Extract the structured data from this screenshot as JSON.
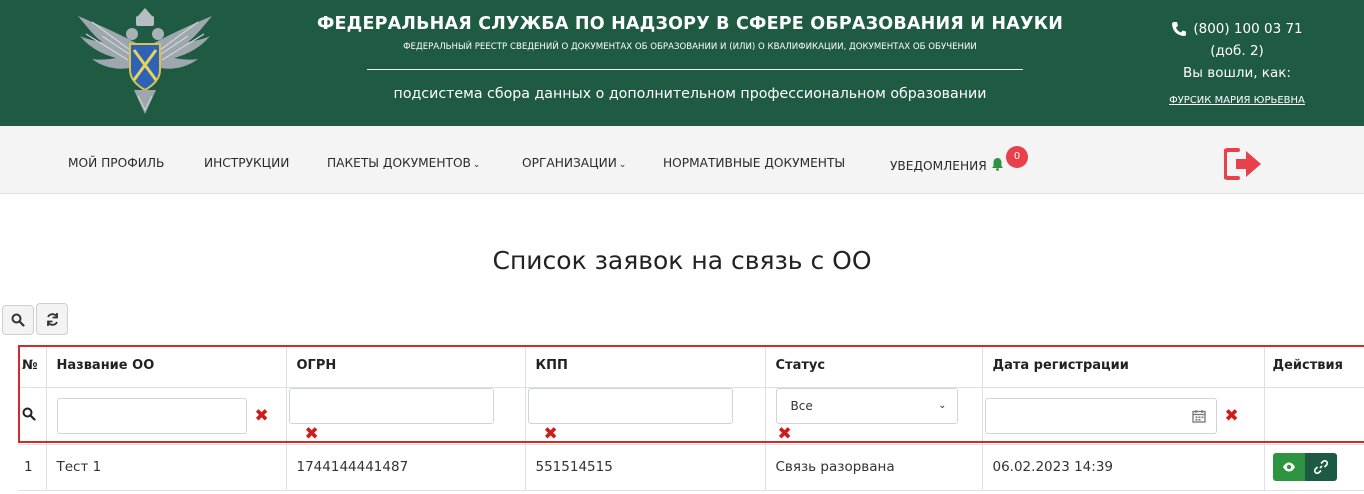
{
  "header": {
    "title": "ФЕДЕРАЛЬНАЯ СЛУЖБА ПО НАДЗОРУ В СФЕРЕ ОБРАЗОВАНИЯ И НАУКИ",
    "subtitle": "ФЕДЕРАЛЬНЫЙ РЕЕСТР СВЕДЕНИЙ О ДОКУМЕНТАХ ОБ ОБРАЗОВАНИИ И (ИЛИ) О КВАЛИФИКАЦИИ, ДОКУМЕНТАХ ОБ ОБУЧЕНИИ",
    "subsystem": "подсистема сбора данных о дополнительном профессиональном образовании",
    "phone": "(800) 100 03 71",
    "ext": "(доб. 2)",
    "logged_in_label": "Вы вошли, как:",
    "user_name": "ФУРСИК МАРИЯ ЮРЬЕВНА"
  },
  "nav": {
    "items": [
      {
        "label": "МОЙ ПРОФИЛЬ"
      },
      {
        "label": "ИНСТРУКЦИИ"
      },
      {
        "label": "ПАКЕТЫ ДОКУМЕНТОВ"
      },
      {
        "label": "ОРГАНИЗАЦИИ"
      },
      {
        "label": "НОРМАТИВНЫЕ ДОКУМЕНТЫ"
      },
      {
        "label": "УВЕДОМЛЕНИЯ"
      }
    ],
    "notifications_count": "0"
  },
  "page_title": "Список заявок на связь с ОО",
  "table": {
    "columns": [
      "№",
      "Название ОО",
      "ОГРН",
      "КПП",
      "Статус",
      "Дата регистрации",
      "Действия"
    ],
    "filters": {
      "name": "",
      "ogrn": "",
      "kpp": "",
      "status": "Все",
      "date": ""
    },
    "rows": [
      {
        "num": "1",
        "name": "Тест 1",
        "ogrn": "1744144441487",
        "kpp": "551514515",
        "status": "Связь разорвана",
        "date": "06.02.2023 14:39"
      }
    ]
  },
  "colors": {
    "header_bg": "#1e5b42",
    "highlight_border": "#d22b2b",
    "clear_x": "#d11b1b",
    "view_button": "#2e9442",
    "link_button": "#1d5a43",
    "badge": "#e8414b",
    "logout_icon": "#e8414b"
  }
}
